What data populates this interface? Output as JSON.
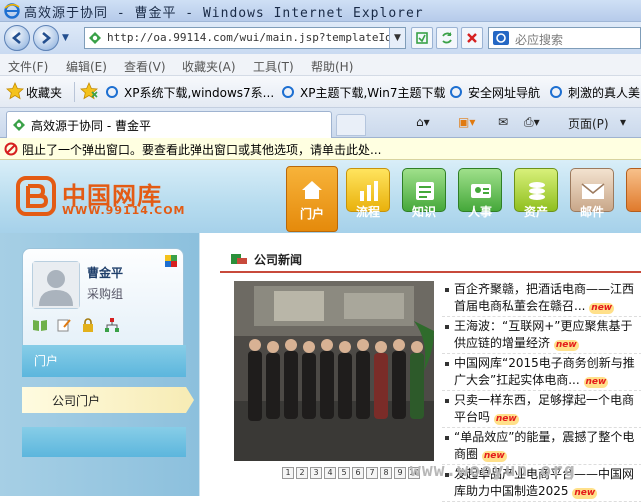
{
  "window": {
    "title": "高效源于协同 - 曹金平 - Windows Internet Explorer"
  },
  "address": {
    "url": "http://oa.99114.com/wui/main.jsp?templateId=1",
    "search_placeholder": "必应搜索"
  },
  "menu": [
    "文件(F)",
    "编辑(E)",
    "查看(V)",
    "收藏夹(A)",
    "工具(T)",
    "帮助(H)"
  ],
  "favorites": {
    "label": "收藏夹",
    "links": [
      "XP系统下载,windows7系...",
      "XP主题下载,Win7主题下载",
      "安全网址导航",
      "刺激的真人美"
    ]
  },
  "tab": {
    "label": "高效源于协同 - 曹金平"
  },
  "commands": {
    "page": "页面(P)"
  },
  "infobar": {
    "message": "阻止了一个弹出窗口。要查看此弹出窗口或其他选项，请单击此处..."
  },
  "site": {
    "logo_text": "中国网库",
    "logo_url": "WWW.99114.COM",
    "nav": [
      "门户",
      "流程",
      "知识",
      "人事",
      "资产",
      "邮件"
    ]
  },
  "user": {
    "name": "曹金平",
    "dept": "采购组"
  },
  "sidebar": {
    "portal": "门户",
    "company_portal": "公司门户"
  },
  "news": {
    "title": "公司新闻",
    "badge": "new",
    "pages": [
      "1",
      "2",
      "3",
      "4",
      "5",
      "6",
      "7",
      "8",
      "9",
      "10"
    ],
    "items": [
      "百企齐聚赣，把酒话电商——江西首届电商私董会在赣召...",
      "王海波：“互联网+”更应聚焦基于供应链的增量经济",
      "中国网库“2015电子商务创新与推广大会”扛起实体电商...",
      "只卖一样东西，足够撑起一个电商平台吗",
      "“单品效应”的能量，震撼了整个电商圈",
      "发起单品产业电商平台——中国网库助力中国制造2025"
    ]
  },
  "watermark": "www.wooyun.org",
  "colors": {
    "accent_orange": "#e35b14",
    "nav_active": "#f0a020",
    "news_rule": "#c84a3b"
  }
}
